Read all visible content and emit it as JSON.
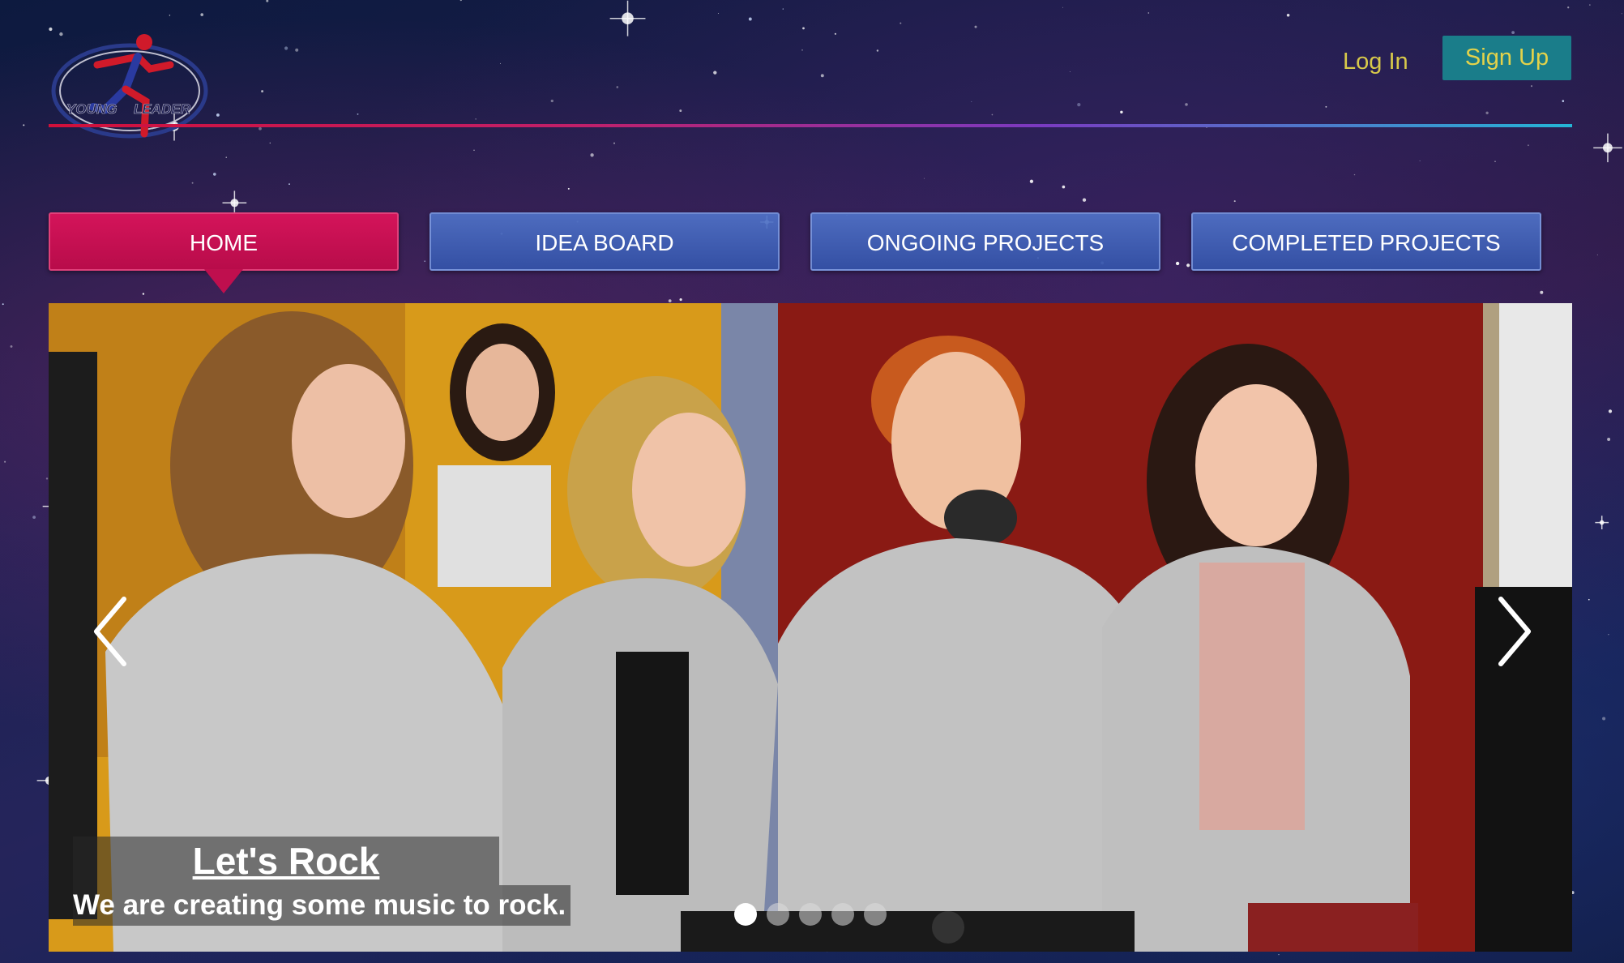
{
  "header": {
    "logo_text": [
      "YOUNG",
      "LEADER"
    ],
    "login_label": "Log In",
    "signup_label": "Sign Up"
  },
  "nav": {
    "tabs": [
      {
        "label": "HOME",
        "active": true
      },
      {
        "label": "IDEA BOARD",
        "active": false
      },
      {
        "label": "ONGOING PROJECTS",
        "active": false
      },
      {
        "label": "COMPLETED PROJECTS",
        "active": false
      }
    ]
  },
  "slider": {
    "caption_title": "Let's Rock",
    "caption_text": "We are creating some music to rock.",
    "slide_count": 5,
    "active_slide": 1,
    "prev_icon": "chevron-left-icon",
    "next_icon": "chevron-right-icon"
  },
  "colors": {
    "active_tab": "#c80f50",
    "tab": "#4468b8",
    "signup_bg": "#1a7d8a",
    "auth_text": "#d8c94a"
  }
}
